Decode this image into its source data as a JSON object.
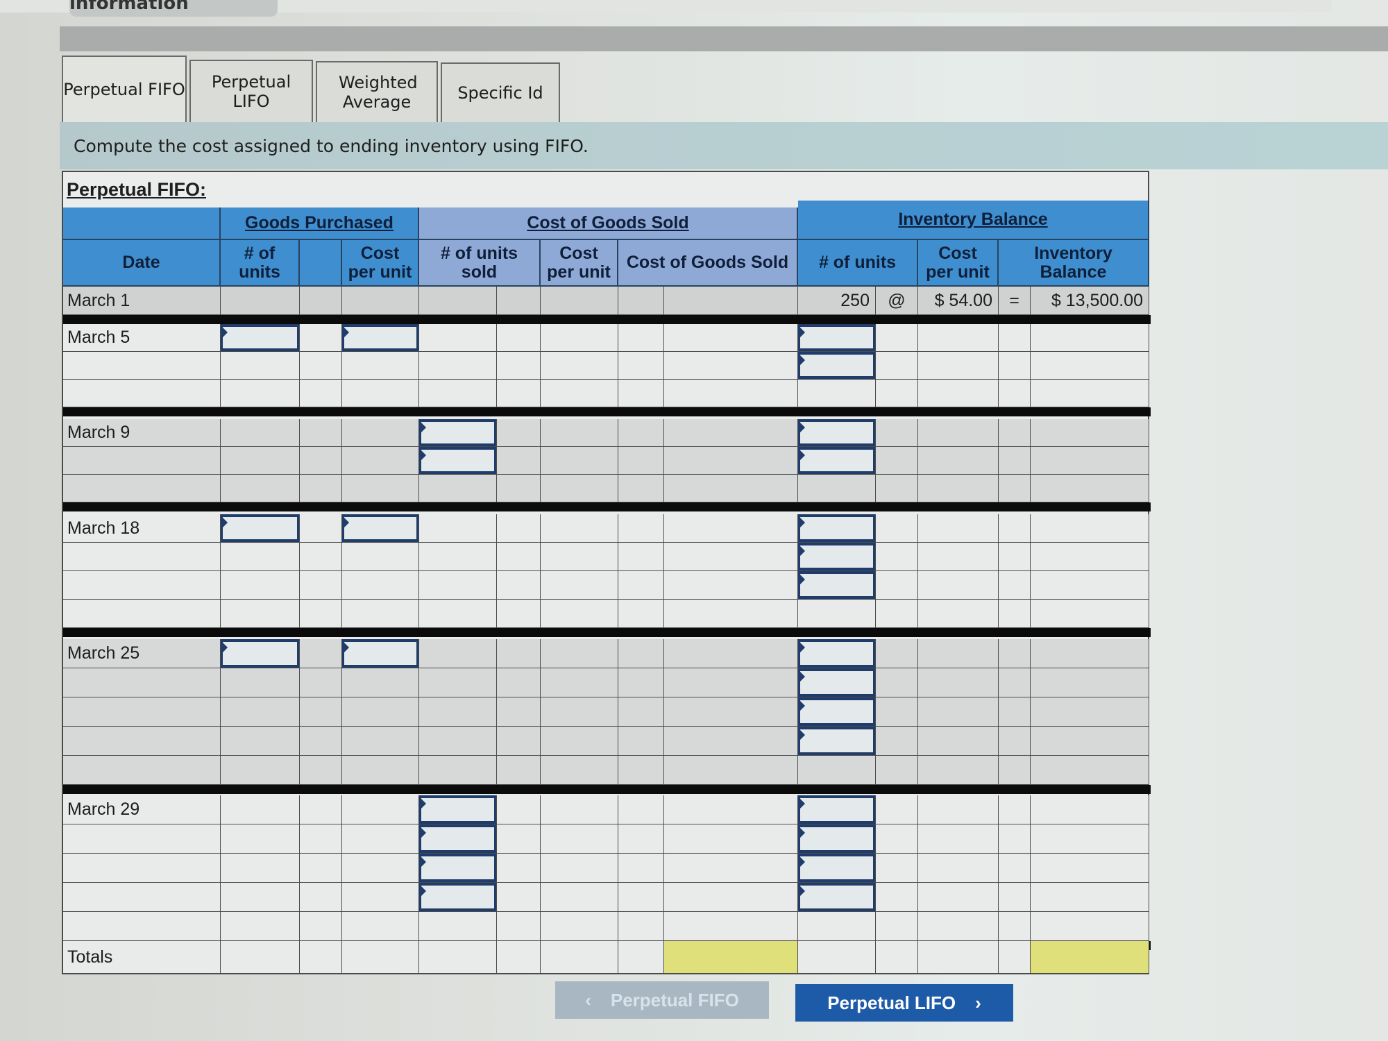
{
  "header": {
    "required_tab_label": "Required information"
  },
  "tabs": [
    {
      "label": "Perpetual FIFO",
      "active": true
    },
    {
      "label": "Perpetual LIFO",
      "active": false
    },
    {
      "label": "Weighted Average",
      "active": false
    },
    {
      "label": "Specific Id",
      "active": false
    }
  ],
  "instruction": "Compute the cost assigned to ending inventory using FIFO.",
  "worksheet": {
    "title": "Perpetual FIFO:",
    "group_headers": {
      "goods_purchased": "Goods Purchased",
      "cost_of_goods_sold": "Cost of Goods Sold",
      "inventory_balance": "Inventory Balance"
    },
    "column_headers": {
      "date": "Date",
      "gp_units": "# of units",
      "gp_cost_per_unit": "Cost per unit",
      "cogs_units_sold": "# of units sold",
      "cogs_cost_per_unit": "Cost per unit",
      "cogs_total": "Cost of Goods Sold",
      "inv_units": "# of units",
      "inv_cost_per_unit": "Cost per unit",
      "inv_balance": "Inventory Balance"
    },
    "symbols": {
      "at": "@",
      "equals": "="
    },
    "rows": {
      "march1": {
        "date": "March 1",
        "inv_units": "250",
        "inv_cost_per_unit": "$ 54.00",
        "inv_balance": "$ 13,500.00"
      },
      "march5": {
        "date": "March 5"
      },
      "march9": {
        "date": "March 9"
      },
      "march18": {
        "date": "March 18"
      },
      "march25": {
        "date": "March 25"
      },
      "march29": {
        "date": "March 29"
      },
      "totals": {
        "date": "Totals"
      }
    }
  },
  "nav": {
    "prev_label": "Perpetual FIFO",
    "prev_icon": "chevron-left-icon",
    "next_label": "Perpetual LIFO",
    "next_icon": "chevron-right-icon"
  }
}
